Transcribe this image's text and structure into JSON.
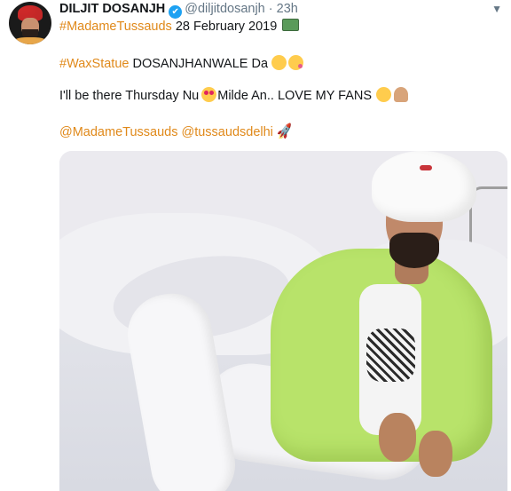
{
  "tweet": {
    "display_name": "DILJIT DOSANJH",
    "verified_glyph": "✔",
    "handle": "@diljitdosanjh",
    "separator": "·",
    "time": "23h",
    "line1": {
      "hashtag": "#MadameTussauds",
      "date": "28 February 2019",
      "emoji": "computer-icon"
    },
    "line2": {
      "hashtag": "#WaxStatue",
      "text": "DOSANJHANWALE Da",
      "emojis": [
        "hugging-face-icon",
        "kissing-face-icon"
      ]
    },
    "line3": {
      "text_before": "I'll be there Thursday Nu",
      "text_after": "Milde An.. LOVE MY FANS",
      "emojis": [
        "heart-eyes-icon",
        "smiling-face-icon",
        "praying-hands-icon"
      ]
    },
    "line4": {
      "mention1": "@MadameTussauds",
      "mention2": "@tussaudsdelhi",
      "rocket": "🚀"
    },
    "caret": "▼",
    "photo": {
      "subject": "man-in-white-turban-photo"
    },
    "colors": {
      "link": "#e0891a",
      "verified": "#1da1f2",
      "muted": "#657786"
    }
  }
}
